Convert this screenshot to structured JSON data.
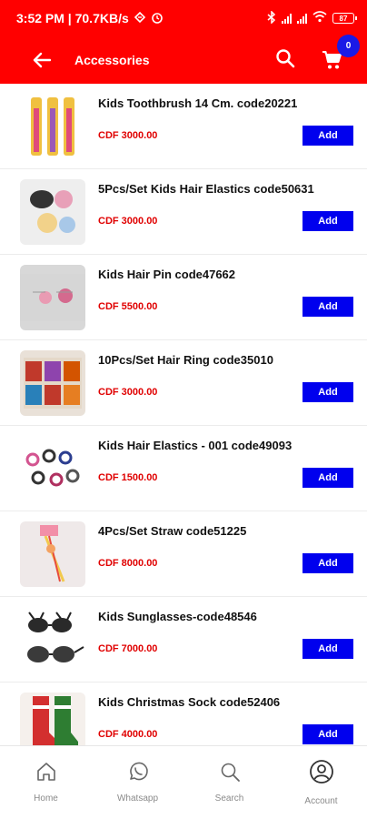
{
  "status_bar": {
    "time_speed": "3:52 PM | 70.7KB/s",
    "battery": "87"
  },
  "header": {
    "title": "Accessories",
    "cart_count": "0"
  },
  "products": [
    {
      "name": "Kids Toothbrush 14 Cm. code20221",
      "price": "CDF 3000.00",
      "add_label": "Add"
    },
    {
      "name": "5Pcs/Set Kids Hair Elastics code50631",
      "price": "CDF 3000.00",
      "add_label": "Add"
    },
    {
      "name": "Kids Hair Pin code47662",
      "price": "CDF 5500.00",
      "add_label": "Add"
    },
    {
      "name": "10Pcs/Set Hair Ring code35010",
      "price": "CDF 3000.00",
      "add_label": "Add"
    },
    {
      "name": "Kids Hair Elastics - 001 code49093",
      "price": "CDF 1500.00",
      "add_label": "Add"
    },
    {
      "name": "4Pcs/Set Straw code51225",
      "price": "CDF 8000.00",
      "add_label": "Add"
    },
    {
      "name": "Kids Sunglasses-code48546",
      "price": "CDF 7000.00",
      "add_label": "Add"
    },
    {
      "name": "Kids Christmas Sock code52406",
      "price": "CDF 4000.00",
      "add_label": "Add"
    }
  ],
  "bottom_nav": [
    {
      "label": "Home",
      "icon": "home-icon"
    },
    {
      "label": "Whatsapp",
      "icon": "whatsapp-icon"
    },
    {
      "label": "Search",
      "icon": "search-icon"
    },
    {
      "label": "Account",
      "icon": "account-icon"
    }
  ],
  "colors": {
    "header_bg": "#ff0000",
    "add_button": "#0000ee",
    "price": "#e00000",
    "cart_badge": "#1a1ae6"
  }
}
